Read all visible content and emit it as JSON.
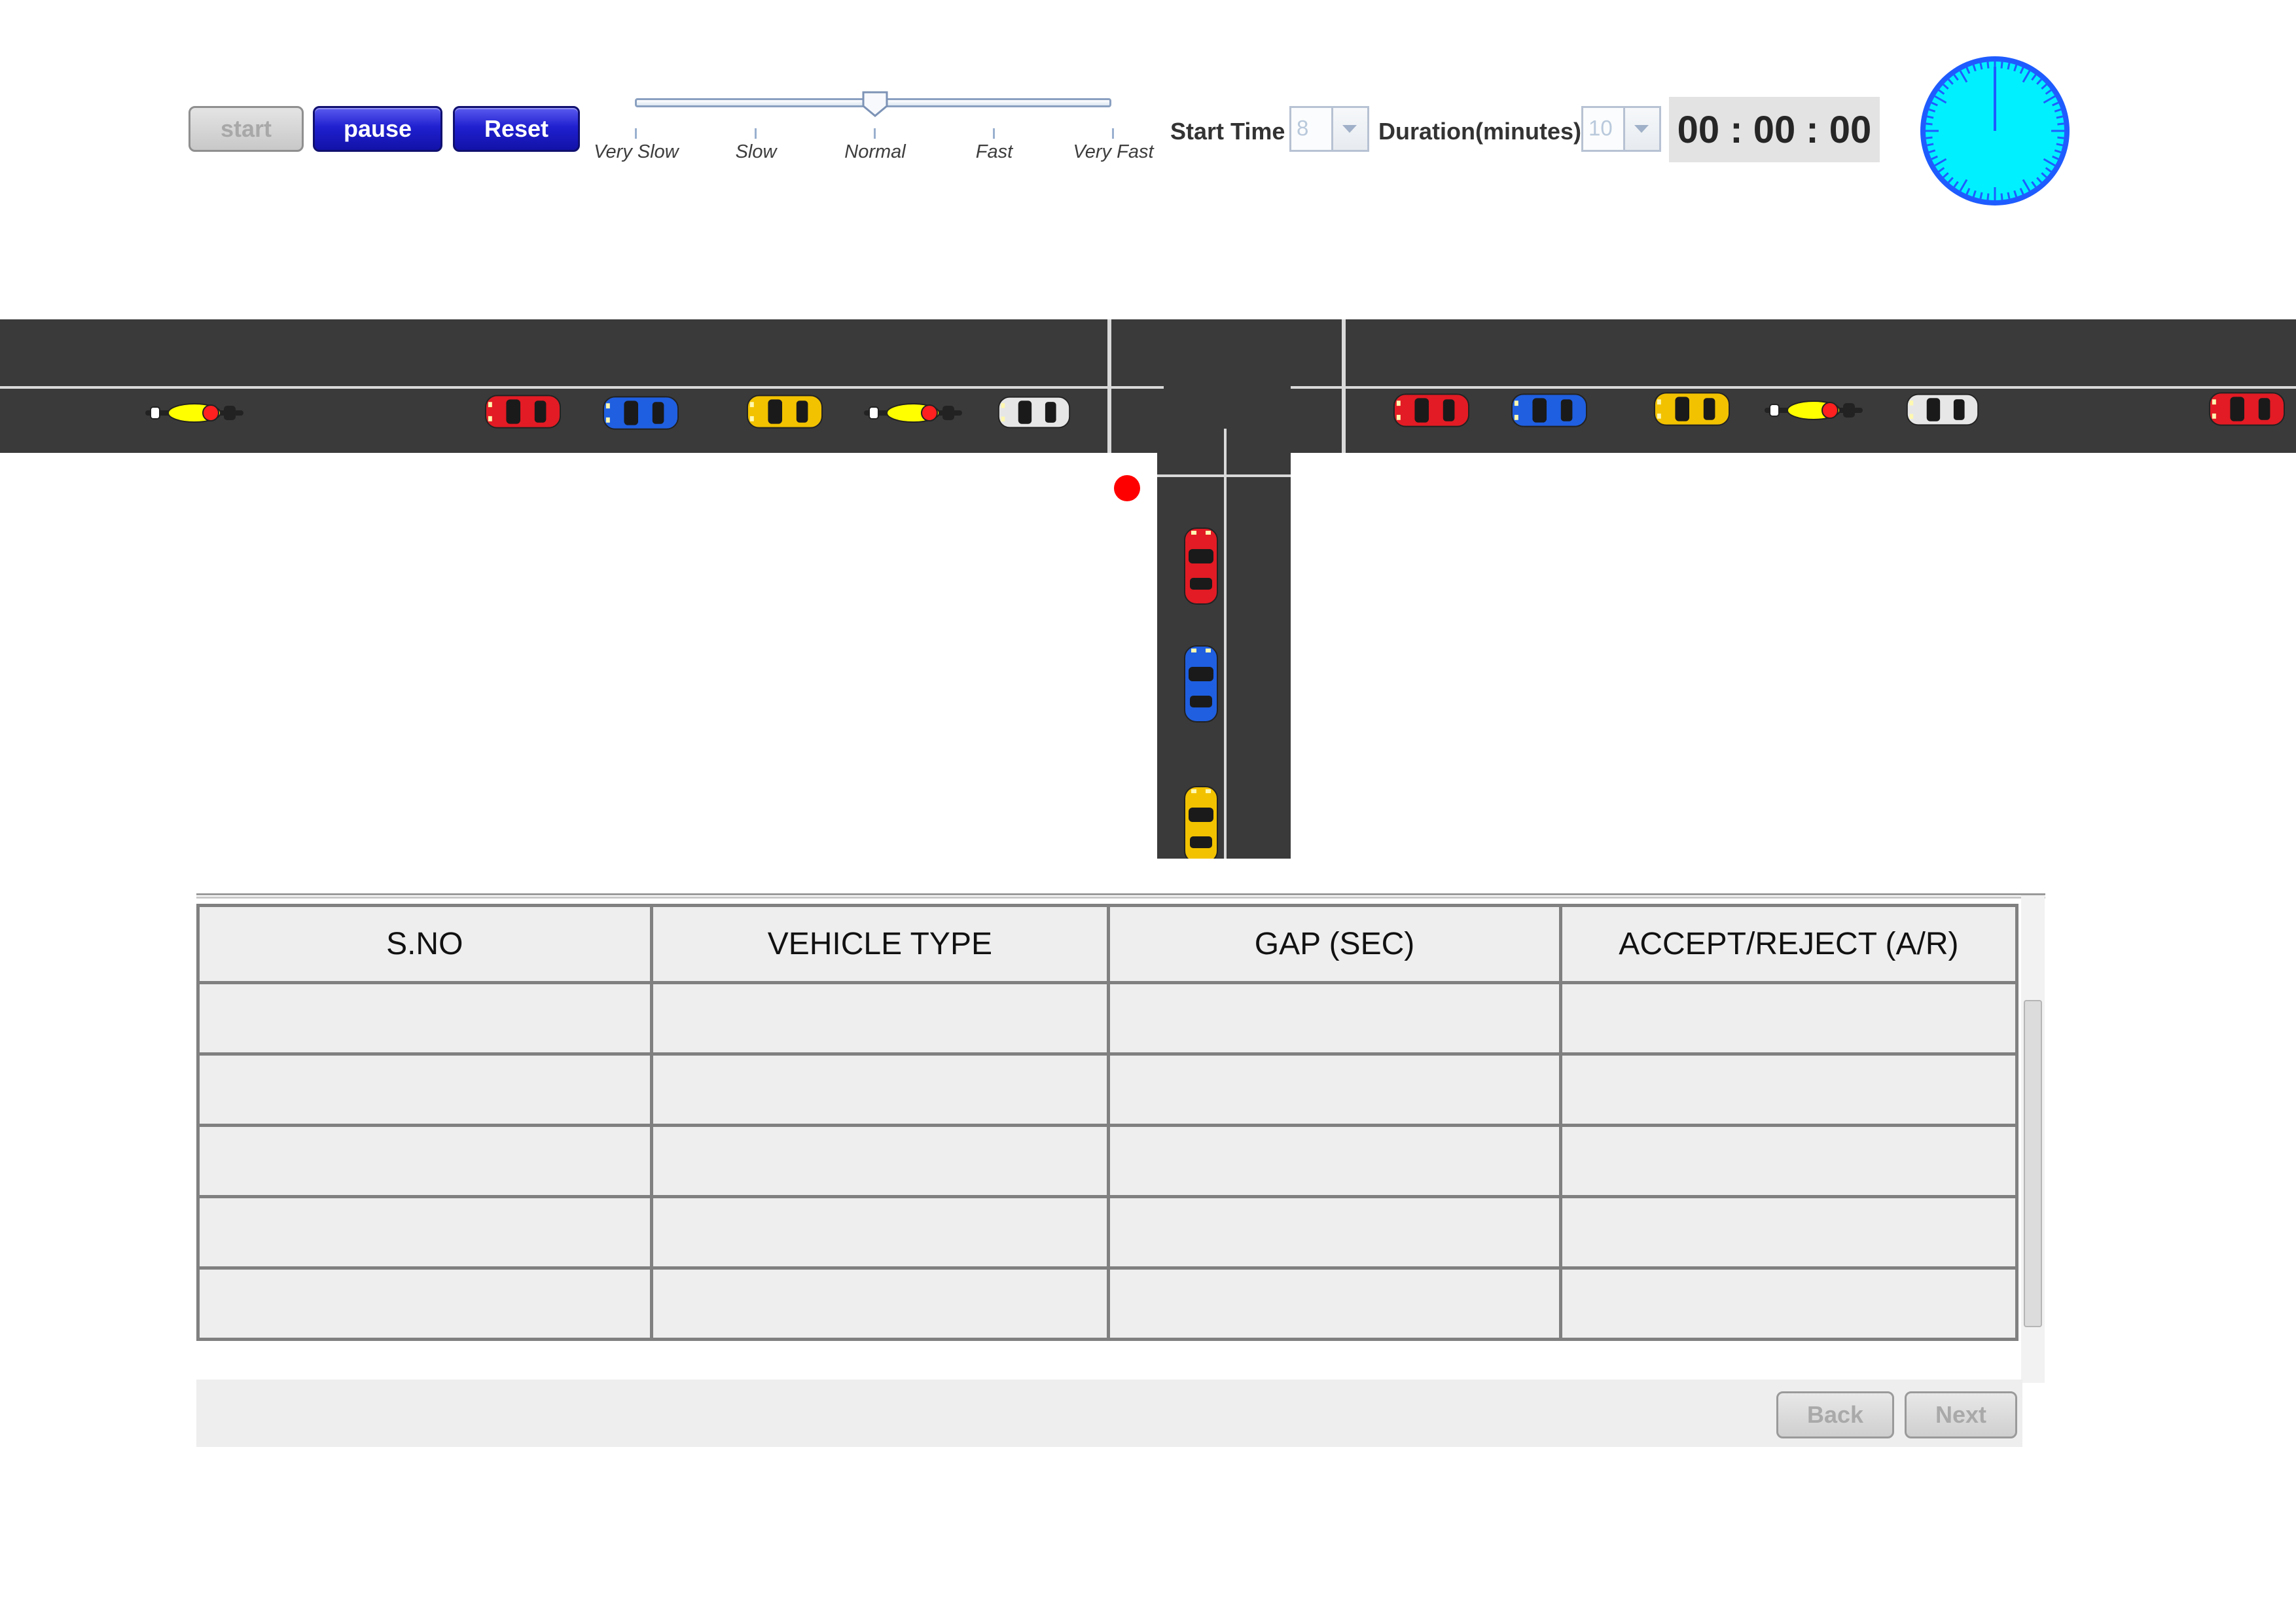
{
  "toolbar": {
    "start_label": "start",
    "pause_label": "pause",
    "reset_label": "Reset",
    "speed_labels": [
      "Very Slow",
      "Slow",
      "Normal",
      "Fast",
      "Very Fast"
    ],
    "speed_selected": "Normal",
    "start_time_label": "Start Time",
    "start_time_value": "8",
    "duration_label": "Duration(minutes)",
    "duration_value": "10",
    "timer_display": "00 : 00 : 00"
  },
  "colors": {
    "road": "#3a3a3a",
    "button_blue": "#2020d0",
    "clock_face": "#00f0ff",
    "clock_border": "#1f5cff",
    "stop_dot": "#ff0000",
    "cell_bg": "#eeeeee"
  },
  "icons": [
    "clock-icon",
    "motorcycle-icon",
    "red-car-icon",
    "blue-car-icon",
    "yellow-taxi-icon",
    "white-car-icon"
  ],
  "table": {
    "headers": [
      "S.NO",
      "VEHICLE TYPE",
      "GAP (SEC)",
      "ACCEPT/REJECT (A/R)"
    ],
    "rows": [
      [
        "",
        "",
        "",
        ""
      ],
      [
        "",
        "",
        "",
        ""
      ],
      [
        "",
        "",
        "",
        ""
      ],
      [
        "",
        "",
        "",
        ""
      ],
      [
        "",
        "",
        "",
        ""
      ]
    ]
  },
  "footer": {
    "back_label": "Back",
    "next_label": "Next"
  }
}
